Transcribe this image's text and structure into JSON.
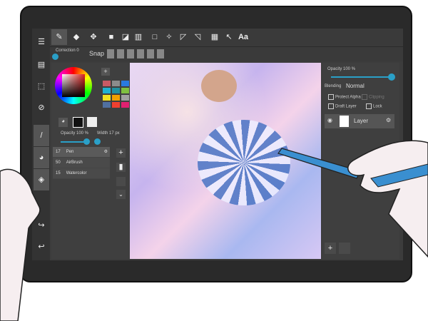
{
  "toolbar": {
    "tools": [
      "pen-icon",
      "eraser-icon",
      "move-icon",
      "fill-rect-icon",
      "bucket-icon",
      "gradient-icon",
      "select-icon",
      "magic-wand-icon",
      "select-pen-icon",
      "select-eraser-icon",
      "panel-icon",
      "operation-icon",
      "text-icon"
    ],
    "text_tool": "Aa"
  },
  "subbar": {
    "correction": "Correction 0",
    "snap": "Snap"
  },
  "sidebar": [
    "menu-icon",
    "page-icon",
    "selection-icon",
    "rotate-icon",
    "brush-icon",
    "palette-icon",
    "layers-icon",
    "redo-icon",
    "undo-icon"
  ],
  "color_panel": {
    "swatches": [
      "#c85a64",
      "#8c8c8c",
      "#2a7ae0",
      "#20b0d0",
      "#2090a0",
      "#80c040",
      "#f0e020",
      "#f0a000",
      "#a0a0a0",
      "#5070a0",
      "#f04030",
      "#e02070"
    ],
    "add": "+"
  },
  "brush_panel": {
    "opacity": "Opacity 100 %",
    "width": "Width 17 px",
    "brushes": [
      {
        "size": "17",
        "name": "Pen"
      },
      {
        "size": "50",
        "name": "AirBrush"
      },
      {
        "size": "15",
        "name": "Watercolor"
      }
    ]
  },
  "layer_panel": {
    "opacity": "Opacity 100 %",
    "blending_label": "Blending",
    "blending": "Normal",
    "protect_alpha": "Protect Alpha",
    "clipping": "Clipping",
    "draft": "Draft Layer",
    "lock": "Lock",
    "layer_name": "Layer"
  },
  "colors": {
    "accent": "#2aa0c8",
    "pen": "#3a8fd0"
  }
}
